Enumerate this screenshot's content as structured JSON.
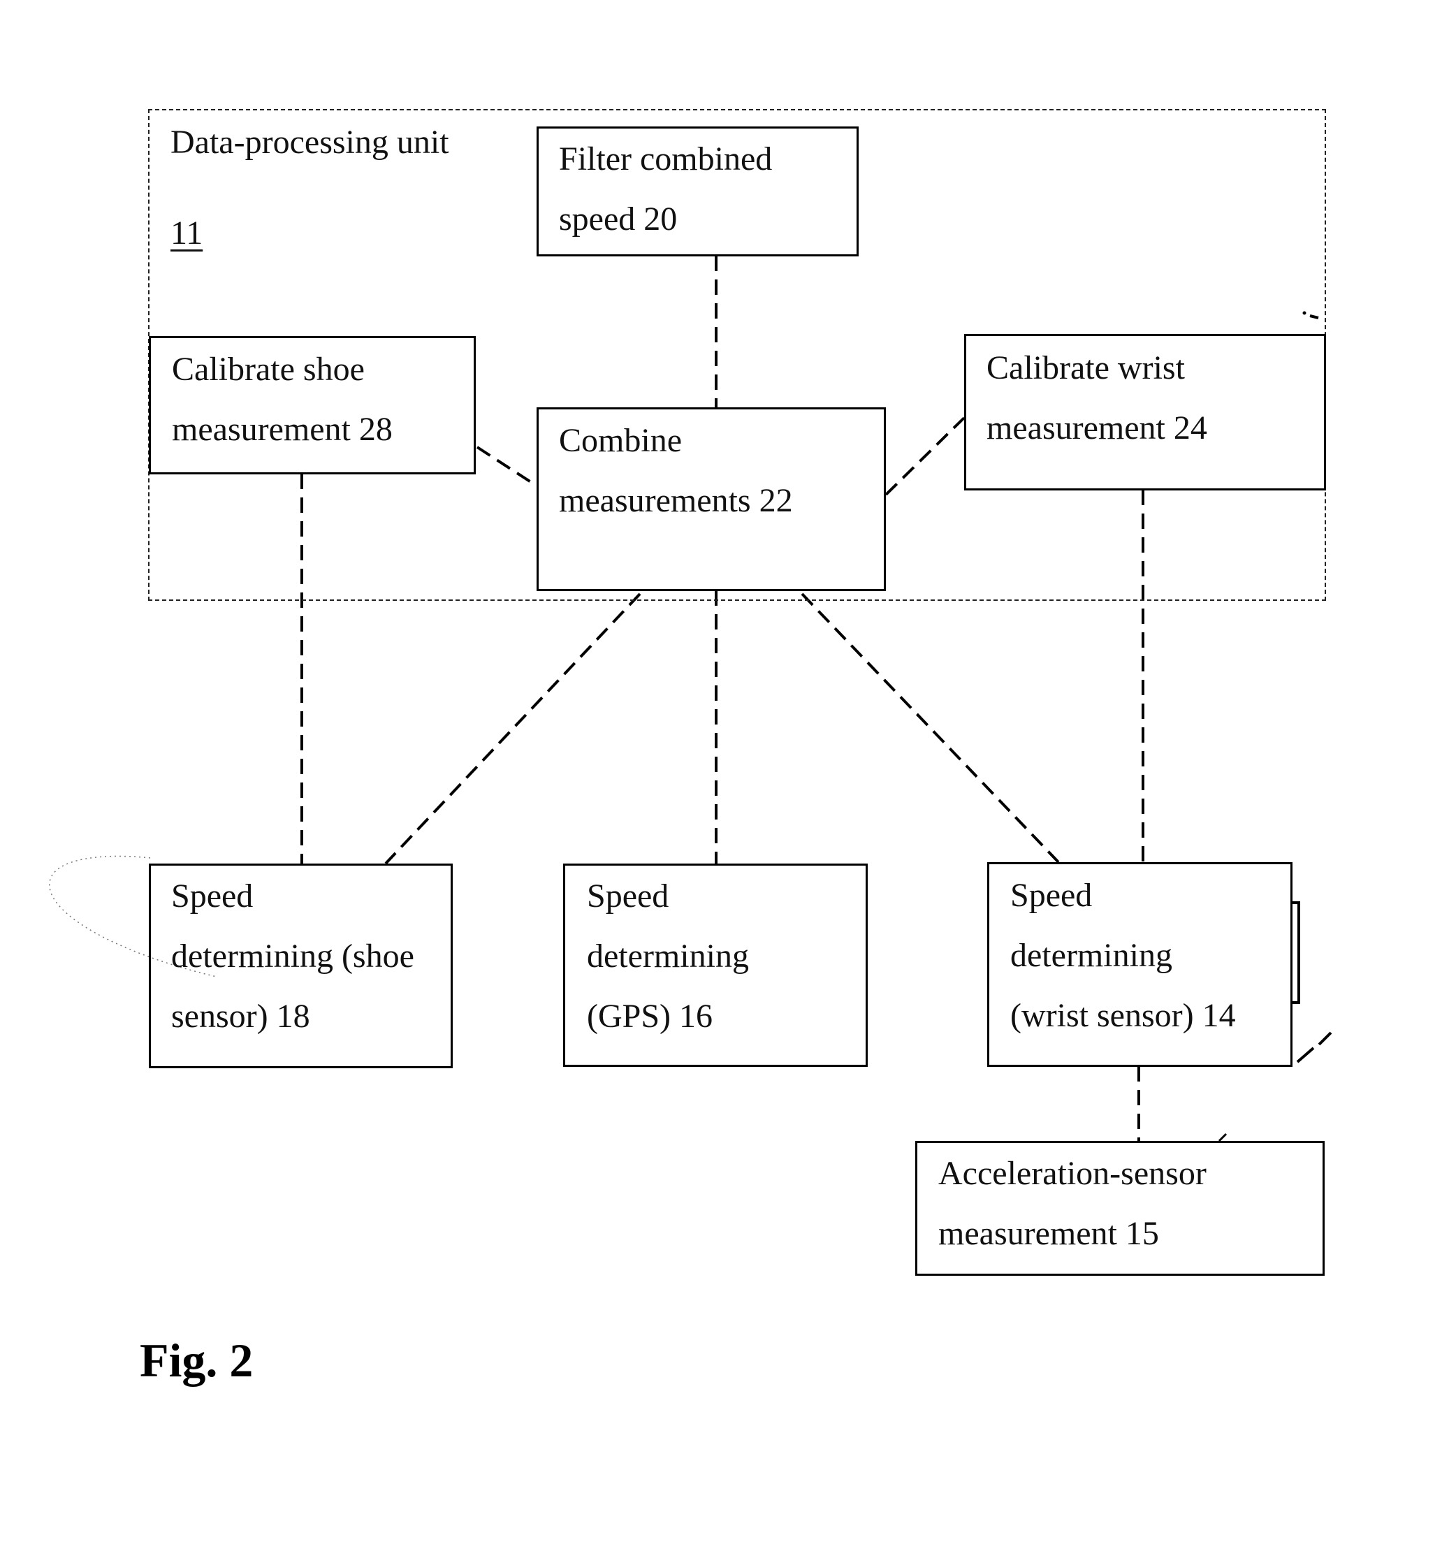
{
  "figure": {
    "caption": "Fig. 2"
  },
  "container": {
    "title": "Data-processing unit",
    "ref": "11"
  },
  "blocks": {
    "filter": {
      "lines": [
        "Filter combined",
        "speed 20"
      ]
    },
    "calibrate_shoe": {
      "lines": [
        "Calibrate shoe",
        "measurement 28"
      ]
    },
    "combine": {
      "lines": [
        "Combine",
        "measurements 22"
      ]
    },
    "calibrate_wrist": {
      "lines": [
        "Calibrate wrist",
        "measurement 24"
      ]
    },
    "speed_shoe": {
      "lines": [
        "Speed",
        "determining (shoe",
        "sensor) 18"
      ]
    },
    "speed_gps": {
      "lines": [
        "Speed",
        "determining",
        "(GPS) 16"
      ]
    },
    "speed_wrist": {
      "lines": [
        "Speed",
        "determining",
        "(wrist sensor) 14"
      ]
    },
    "accel": {
      "lines": [
        "Acceleration-sensor",
        "measurement 15"
      ]
    }
  },
  "connections": [
    {
      "from": "filter",
      "to": "combine"
    },
    {
      "from": "calibrate_shoe",
      "to": "combine"
    },
    {
      "from": "calibrate_wrist",
      "to": "combine"
    },
    {
      "from": "calibrate_shoe",
      "to": "speed_shoe"
    },
    {
      "from": "calibrate_wrist",
      "to": "speed_wrist"
    },
    {
      "from": "combine",
      "to": "speed_shoe"
    },
    {
      "from": "combine",
      "to": "speed_gps"
    },
    {
      "from": "combine",
      "to": "speed_wrist"
    },
    {
      "from": "speed_wrist",
      "to": "accel"
    }
  ]
}
